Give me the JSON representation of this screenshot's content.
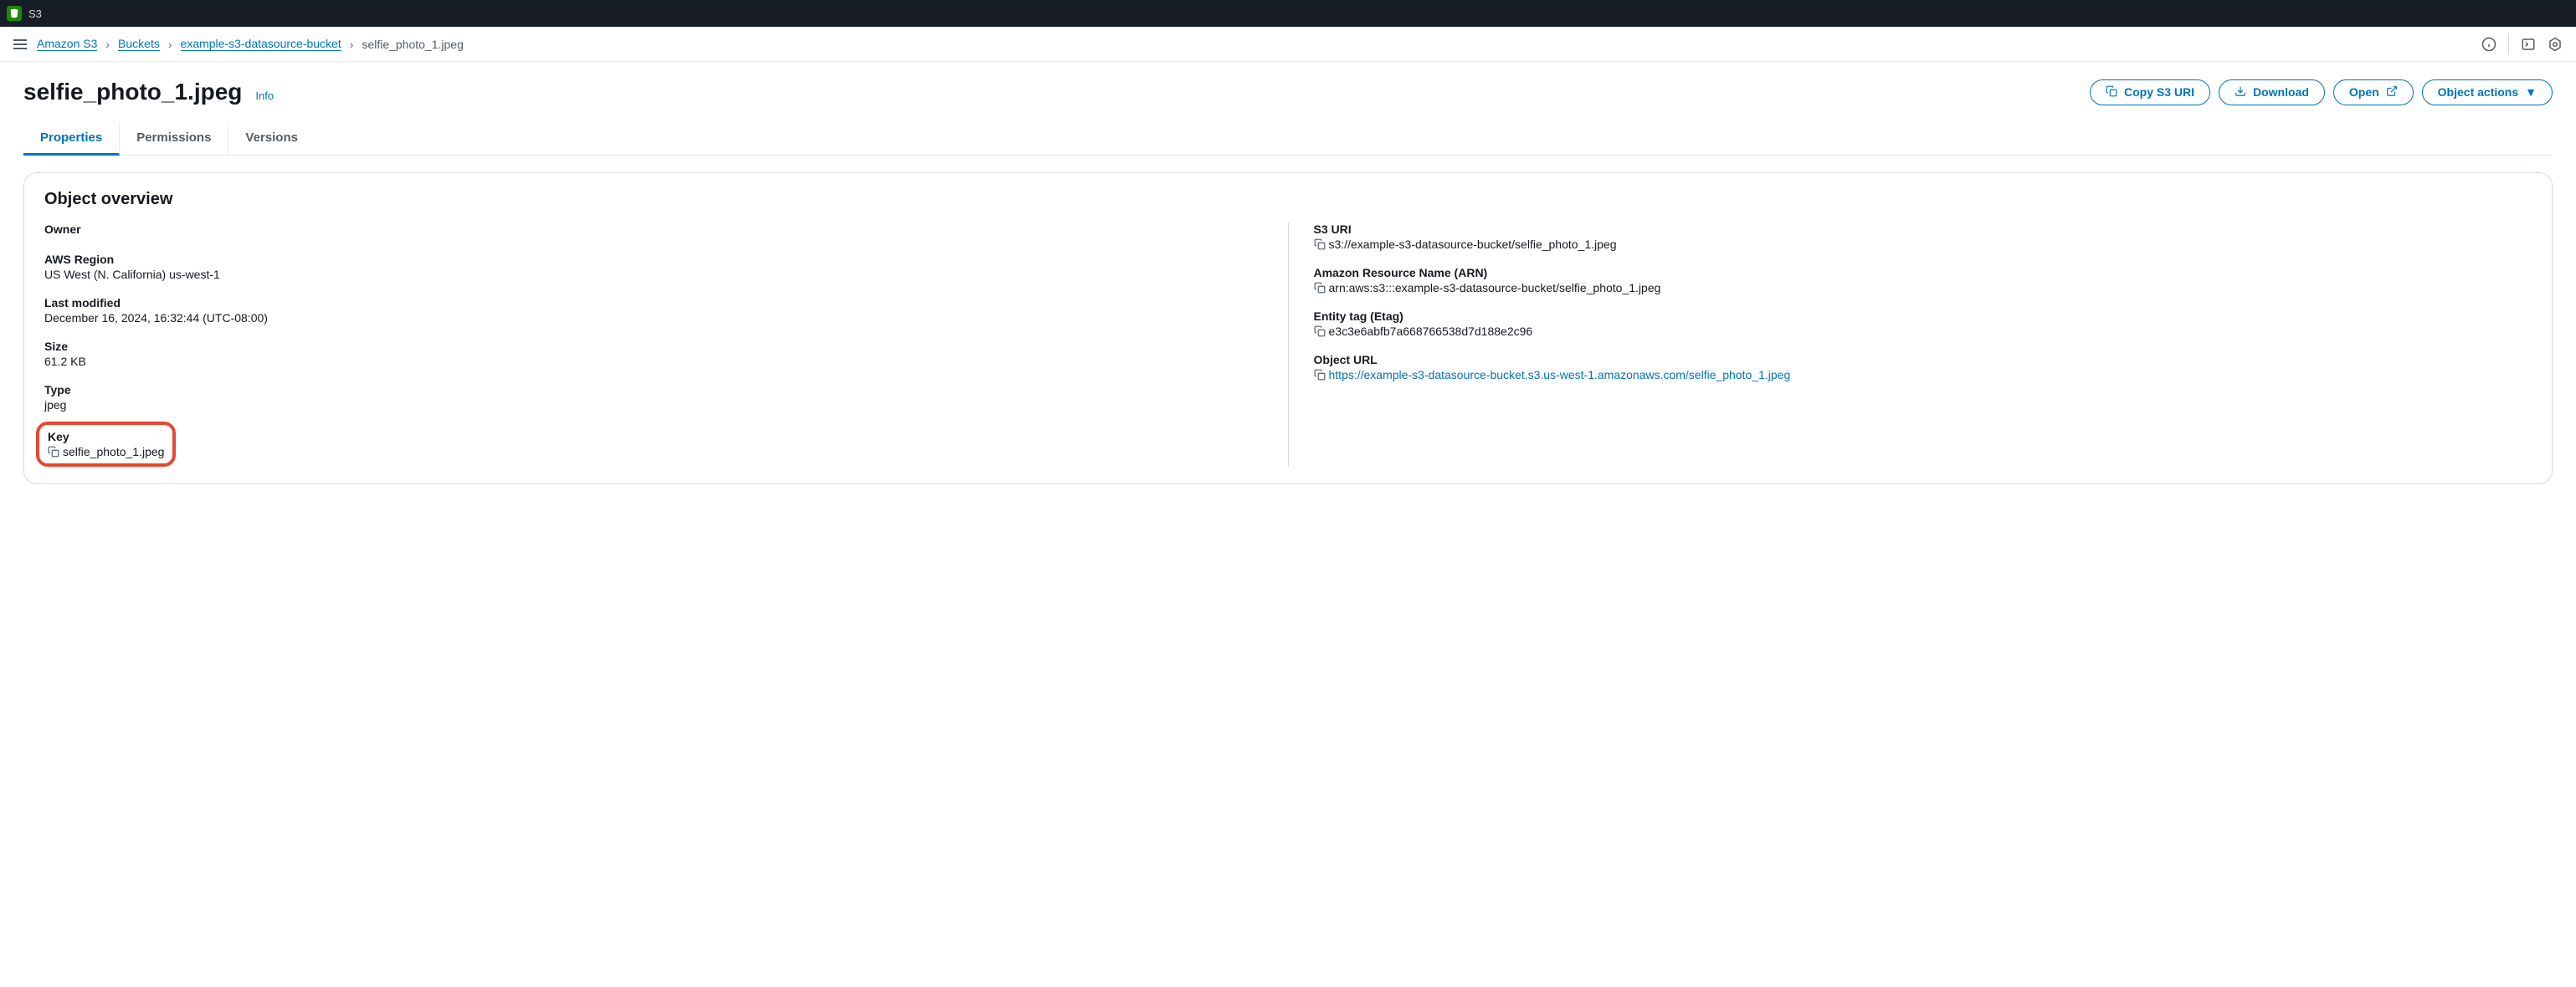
{
  "topbar": {
    "label": "S3"
  },
  "breadcrumb": {
    "items": [
      {
        "label": "Amazon S3",
        "link": true
      },
      {
        "label": "Buckets",
        "link": true
      },
      {
        "label": "example-s3-datasource-bucket",
        "link": true
      },
      {
        "label": "selfie_photo_1.jpeg",
        "link": false
      }
    ]
  },
  "title": "selfie_photo_1.jpeg",
  "info_label": "Info",
  "actions": {
    "copy_uri": "Copy S3 URI",
    "download": "Download",
    "open": "Open",
    "object_actions": "Object actions"
  },
  "tabs": {
    "properties": "Properties",
    "permissions": "Permissions",
    "versions": "Versions"
  },
  "overview": {
    "heading": "Object overview",
    "left": {
      "owner": {
        "label": "Owner",
        "value": ""
      },
      "region": {
        "label": "AWS Region",
        "value": "US West (N. California) us-west-1"
      },
      "last_modified": {
        "label": "Last modified",
        "value": "December 16, 2024, 16:32:44 (UTC-08:00)"
      },
      "size": {
        "label": "Size",
        "value": "61.2 KB"
      },
      "type": {
        "label": "Type",
        "value": "jpeg"
      },
      "key": {
        "label": "Key",
        "value": "selfie_photo_1.jpeg"
      }
    },
    "right": {
      "s3_uri": {
        "label": "S3 URI",
        "value": "s3://example-s3-datasource-bucket/selfie_photo_1.jpeg"
      },
      "arn": {
        "label": "Amazon Resource Name (ARN)",
        "value": "arn:aws:s3:::example-s3-datasource-bucket/selfie_photo_1.jpeg"
      },
      "etag": {
        "label": "Entity tag (Etag)",
        "value": "e3c3e6abfb7a668766538d7d188e2c96"
      },
      "url": {
        "label": "Object URL",
        "value": "https://example-s3-datasource-bucket.s3.us-west-1.amazonaws.com/selfie_photo_1.jpeg"
      }
    }
  }
}
